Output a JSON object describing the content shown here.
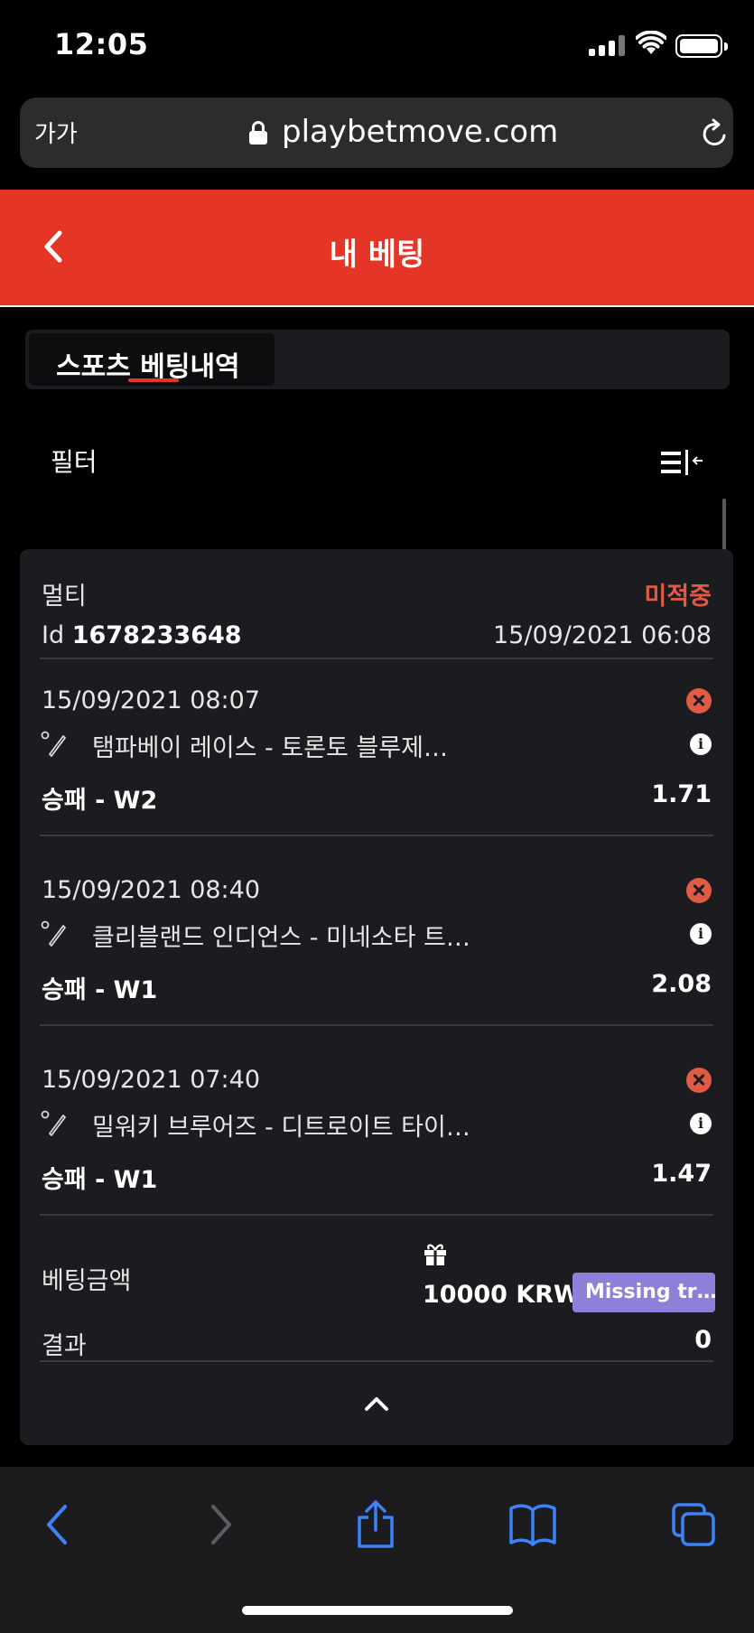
{
  "status_bar": {
    "time": "12:05"
  },
  "browser": {
    "aa_label": "가가",
    "url": "playbetmove.com"
  },
  "header": {
    "title": "내 베팅"
  },
  "tabs": [
    {
      "label": "스포츠 베팅내역",
      "active": true
    }
  ],
  "filter": {
    "label": "필터"
  },
  "bet": {
    "type": "멀티",
    "status": "미적중",
    "id_prefix": "Id",
    "id": "1678233648",
    "placed_at": "15/09/2021 06:08",
    "selections": [
      {
        "datetime": "15/09/2021 08:07",
        "match": "탬파베이 레이스 - 토론토 블루제…",
        "market": "승패 - W2",
        "odds": "1.71"
      },
      {
        "datetime": "15/09/2021 08:40",
        "match": "클리블랜드 인디언스 - 미네소타 트…",
        "market": "승패 - W1",
        "odds": "2.08"
      },
      {
        "datetime": "15/09/2021 07:40",
        "match": "밀워키 브루어즈 - 디트로이트 타이…",
        "market": "승패 - W1",
        "odds": "1.47"
      }
    ],
    "stake_label": "베팅금액",
    "stake": "10000 KRW",
    "bonus_badge": "Missing tr…",
    "result_label": "결과",
    "result": "0"
  },
  "colors": {
    "brand": "#e53527",
    "lost": "#e05a44",
    "badge": "#8f7fd8",
    "safari_blue": "#3d82f6"
  }
}
